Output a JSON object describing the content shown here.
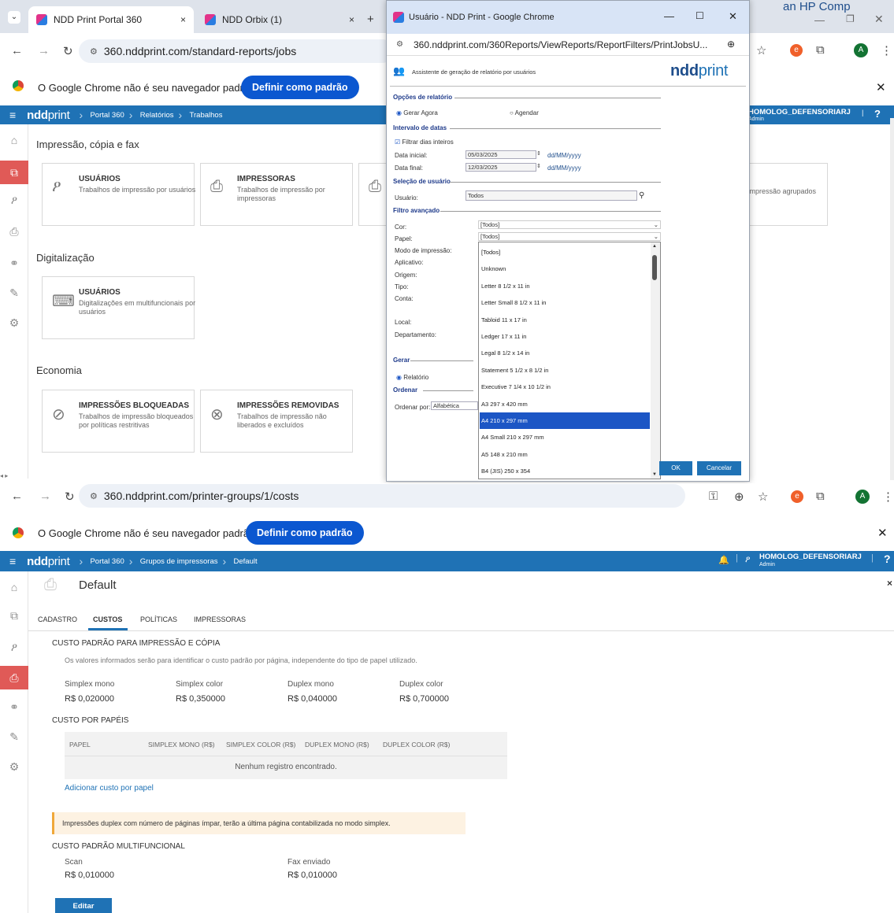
{
  "top_right_text": "an HP Comp",
  "win1": {
    "tabs": [
      {
        "label": "NDD Print Portal 360",
        "close": "×"
      },
      {
        "label": "NDD Orbix (1)",
        "close": "×"
      }
    ],
    "new_tab": "+",
    "url": "360.nddprint.com/standard-reports/jobs",
    "infobar_text": "O Google Chrome não é seu navegador padrão",
    "infobar_button": "Definir como padrão",
    "logo_bold": "ndd",
    "logo_thin": "print",
    "breadcrumb": [
      "Portal 360",
      "Relatórios",
      "Trabalhos"
    ],
    "user": {
      "name": "HOMOLOG_DEFENSORIARJ",
      "role": "Admin"
    },
    "help": "?",
    "sections": [
      {
        "title": "Impressão, cópia e fax"
      },
      {
        "title": "Digitalização"
      },
      {
        "title": "Economia"
      }
    ],
    "cards": [
      {
        "title": "USUÁRIOS",
        "desc": "Trabalhos de impressão por usuários"
      },
      {
        "title": "IMPRESSORAS",
        "desc": "Trabalhos de impressão por impressoras"
      },
      {
        "title": "",
        "desc": "e impressão agrupados"
      },
      {
        "title": "USUÁRIOS",
        "desc": "Digitalizações em multifuncionais por usuários"
      },
      {
        "title": "IMPRESSÕES BLOQUEADAS",
        "desc": "Trabalhos de impressão bloqueados por políticas restritivas"
      },
      {
        "title": "IMPRESSÕES REMOVIDAS",
        "desc": "Trabalhos de impressão não liberados e excluídos"
      }
    ]
  },
  "popup": {
    "title": "Usuário - NDD Print - Google Chrome",
    "url": "360.nddprint.com/360Reports/ViewReports/ReportFilters/PrintJobsU...",
    "heading": "Assistente de geração de relatório por usuários",
    "logo_bold": "ndd",
    "logo_thin": "print",
    "groups": {
      "opcoes": "Opções de relatório",
      "intervalo": "Intervalo de datas",
      "selecao": "Seleção de usuário",
      "filtro": "Filtro avançado",
      "gerar": "Gerar",
      "ordenar": "Ordenar"
    },
    "radio_gerar_agora": "Gerar Agora",
    "radio_agendar": "Agendar",
    "chk_filtrar": "Filtrar dias inteiros",
    "data_inicial_label": "Data inicial:",
    "data_inicial": "05/03/2025",
    "data_final_label": "Data final:",
    "data_final": "12/03/2025",
    "date_format": "dd/MM/yyyy",
    "usuario_label": "Usuário:",
    "usuario_value": "Todos",
    "filters": [
      "Cor:",
      "Papel:",
      "Modo de impressão:",
      "Aplicativo:",
      "Origem:",
      "Tipo:",
      "Conta:",
      "Local:",
      "Departamento:"
    ],
    "cor_value": "[Todos]",
    "papel_value": "[Todos]",
    "relatorio": "Relatório",
    "ordenar_por_label": "Ordenar por:",
    "ordenar_por_value": "Alfabética",
    "dropdown_options": [
      "[Todos]",
      "Unknown",
      "Letter 8 1/2 x 11 in",
      "Letter Small 8 1/2 x 11 in",
      "Tabloid 11 x 17 in",
      "Ledger 17 x 11 in",
      "Legal 8 1/2 x 14 in",
      "Statement 5 1/2 x 8 1/2 in",
      "Executive 7 1/4 x 10 1/2 in",
      "A3 297 x 420 mm",
      "A4 210 x 297 mm",
      "A4 Small 210 x 297 mm",
      "A5 148 x 210 mm",
      "B4 (JIS) 250 x 354"
    ],
    "selected_option": "A4 210 x 297 mm",
    "ok": "OK",
    "cancel": "Cancelar"
  },
  "win2": {
    "url": "360.nddprint.com/printer-groups/1/costs",
    "infobar_text": "O Google Chrome não é seu navegador padrão",
    "infobar_button": "Definir como padrão",
    "logo_bold": "ndd",
    "logo_thin": "print",
    "breadcrumb": [
      "Portal 360",
      "Grupos de impressoras",
      "Default"
    ],
    "user": {
      "name": "HOMOLOG_DEFENSORIARJ",
      "role": "Admin"
    },
    "help": "?",
    "page_title": "Default",
    "tabs": [
      "CADASTRO",
      "CUSTOS",
      "POLÍTICAS",
      "IMPRESSORAS"
    ],
    "active_tab": "CUSTOS",
    "sec1_title": "CUSTO PADRÃO PARA IMPRESSÃO E CÓPIA",
    "sec1_desc": "Os valores informados serão para identificar o custo padrão por página, independente do tipo de papel utilizado.",
    "costs": [
      {
        "label": "Simplex mono",
        "value": "R$ 0,020000"
      },
      {
        "label": "Simplex color",
        "value": "R$ 0,350000"
      },
      {
        "label": "Duplex mono",
        "value": "R$ 0,040000"
      },
      {
        "label": "Duplex color",
        "value": "R$ 0,700000"
      }
    ],
    "sec2_title": "CUSTO POR PAPÉIS",
    "table_headers": [
      "PAPEL",
      "SIMPLEX MONO (R$)",
      "SIMPLEX COLOR (R$)",
      "DUPLEX MONO (R$)",
      "DUPLEX COLOR (R$)"
    ],
    "empty_text": "Nenhum registro encontrado.",
    "add_link": "Adicionar custo por papel",
    "warning": "Impressões duplex com número de páginas ímpar, terão a última página contabilizada no modo simplex.",
    "sec3_title": "CUSTO PADRÃO MULTIFUNCIONAL",
    "mf_costs": [
      {
        "label": "Scan",
        "value": "R$ 0,010000"
      },
      {
        "label": "Fax enviado",
        "value": "R$ 0,010000"
      }
    ],
    "edit_button": "Editar"
  },
  "colors": {
    "brand": "#1f72b5",
    "accent_red": "#e05a57",
    "chrome_blue": "#0b57d0",
    "selected": "#1c56c5"
  }
}
